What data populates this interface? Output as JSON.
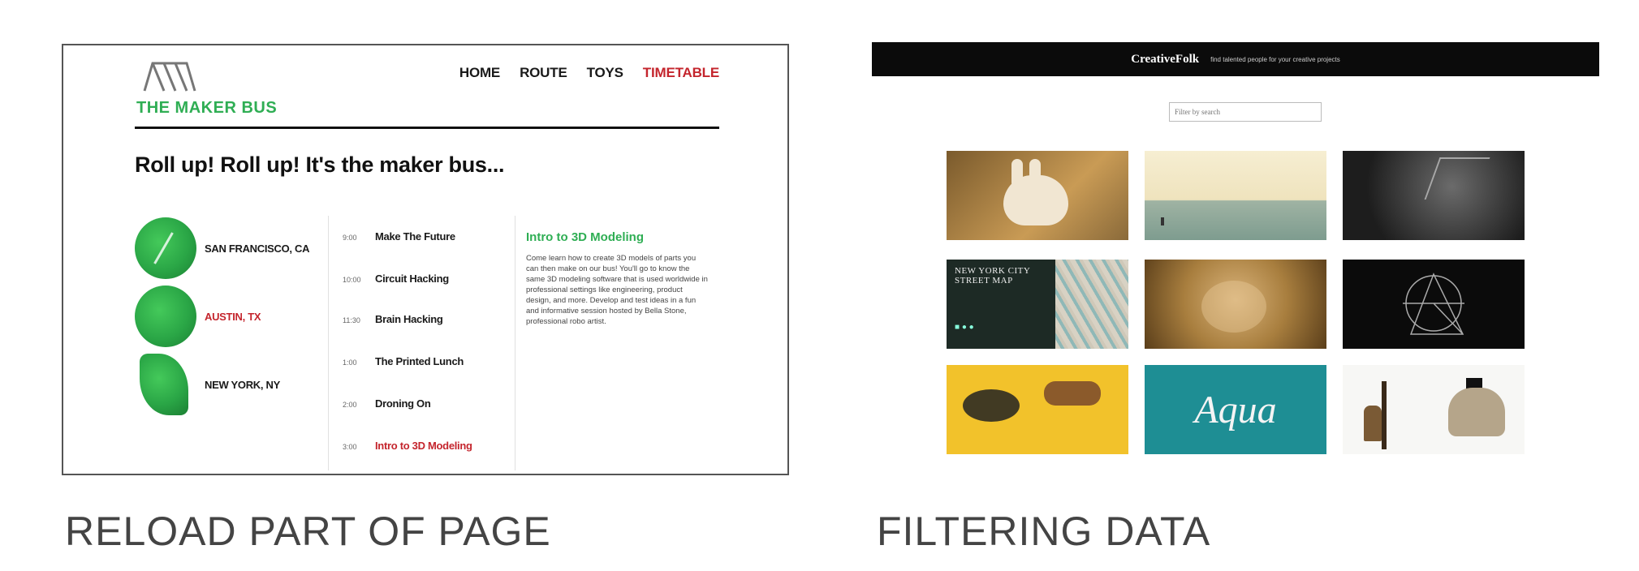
{
  "maker_bus": {
    "brand": "THE MAKER BUS",
    "nav": [
      "HOME",
      "ROUTE",
      "TOYS",
      "TIMETABLE"
    ],
    "nav_active": "TIMETABLE",
    "heading": "Roll up! Roll up! It's the maker bus...",
    "locations": [
      {
        "label": "SAN FRANCISCO, CA",
        "active": false
      },
      {
        "label": "AUSTIN, TX",
        "active": true
      },
      {
        "label": "NEW YORK, NY",
        "active": false
      }
    ],
    "schedule": [
      {
        "time": "9:00",
        "event": "Make The Future"
      },
      {
        "time": "10:00",
        "event": "Circuit Hacking"
      },
      {
        "time": "11:30",
        "event": "Brain Hacking"
      },
      {
        "time": "1:00",
        "event": "The Printed Lunch"
      },
      {
        "time": "2:00",
        "event": "Droning On"
      },
      {
        "time": "3:00",
        "event": "Intro to 3D Modeling"
      }
    ],
    "detail": {
      "title": "Intro to 3D Modeling",
      "body": "Come learn how to create 3D models of parts you can then make on our bus! You'll go to know the same 3D modeling software that is used worldwide in professional settings like engineering, product design, and more. Develop and test ideas in a fun and informative session hosted by Bella Stone, professional robo artist."
    },
    "colors": {
      "brand_green": "#2fae54",
      "active_red": "#c4252d"
    }
  },
  "creative_folk": {
    "name": "CreativeFolk",
    "tagline": "find talented people for your creative projects",
    "filter_placeholder": "Filter by search",
    "tiles": [
      {
        "icon": "rabbit-illustration"
      },
      {
        "icon": "seascape-photo"
      },
      {
        "icon": "deer-photo"
      },
      {
        "icon": "street-map",
        "text": "NEW YORK CITY STREET MAP"
      },
      {
        "icon": "bear-photo"
      },
      {
        "icon": "geometric-logo"
      },
      {
        "icon": "dog-illustration"
      },
      {
        "icon": "aqua-lettering",
        "text": "Aqua"
      },
      {
        "icon": "figures-illustration"
      }
    ]
  },
  "captions": {
    "left": "RELOAD PART OF PAGE",
    "right": "FILTERING DATA"
  }
}
